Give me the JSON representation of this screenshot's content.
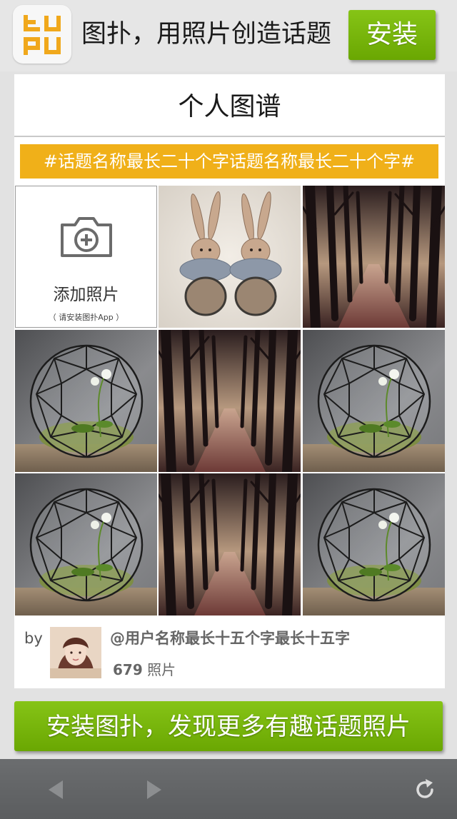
{
  "banner": {
    "logo_text": "tupu",
    "title": "图扑，用照片创造话题",
    "install_label": "安装"
  },
  "card": {
    "title": "个人图谱",
    "topic": "#话题名称最长二十个字话题名称最长二十个字#",
    "add_photo": {
      "label": "添加照片",
      "hint": "（ 请安装图扑App ）"
    },
    "photos": [
      {
        "subject": "rabbit-figurines"
      },
      {
        "subject": "forest-path"
      },
      {
        "subject": "glass-terrarium"
      },
      {
        "subject": "forest-path"
      },
      {
        "subject": "glass-terrarium"
      },
      {
        "subject": "glass-terrarium"
      },
      {
        "subject": "forest-path"
      },
      {
        "subject": "glass-terrarium"
      }
    ],
    "by_label": "by",
    "username": "@用户名称最长十五个字最长十五字",
    "photo_count": "679",
    "photo_unit": "照片"
  },
  "cta": {
    "label": "安装图扑，发现更多有趣话题照片"
  },
  "toolbar": {
    "back_icon": "back-arrow-icon",
    "forward_icon": "forward-arrow-icon",
    "refresh_icon": "refresh-icon"
  },
  "colors": {
    "accent_green": "#7ab80e",
    "topic_yellow": "#f0b019",
    "logo_orange": "#f0a81c",
    "toolbar_gray": "#636567"
  }
}
